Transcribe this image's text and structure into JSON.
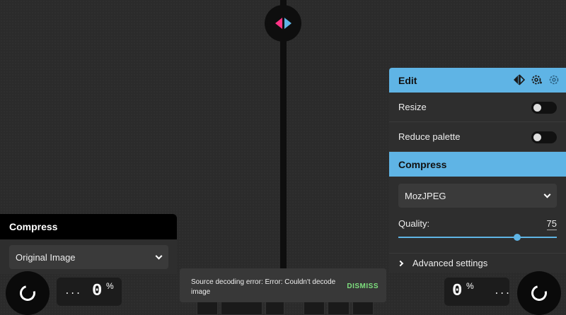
{
  "left_panel": {
    "title": "Compress",
    "select_value": "Original Image"
  },
  "right_panel": {
    "edit_title": "Edit",
    "resize_label": "Resize",
    "resize_on": false,
    "reduce_palette_label": "Reduce palette",
    "reduce_palette_on": false,
    "compress_title": "Compress",
    "codec_value": "MozJPEG",
    "quality_label": "Quality:",
    "quality_value": "75",
    "quality_fraction": 0.75,
    "advanced_label": "Advanced settings"
  },
  "left_stats": {
    "size": "...",
    "percent": "0",
    "percent_sign": "%"
  },
  "right_stats": {
    "size": "...",
    "percent": "0",
    "percent_sign": "%"
  },
  "toast": {
    "message": "Source decoding error: Error: Couldn't decode image",
    "action": "DISMISS"
  },
  "colors": {
    "accent": "#5fb4e5",
    "handle_left": "#ff3385",
    "dismiss": "#7ee07e"
  },
  "icons": [
    "swap-sides-icon",
    "copy-settings-icon",
    "save-settings-icon",
    "loading-spinner-icon"
  ]
}
